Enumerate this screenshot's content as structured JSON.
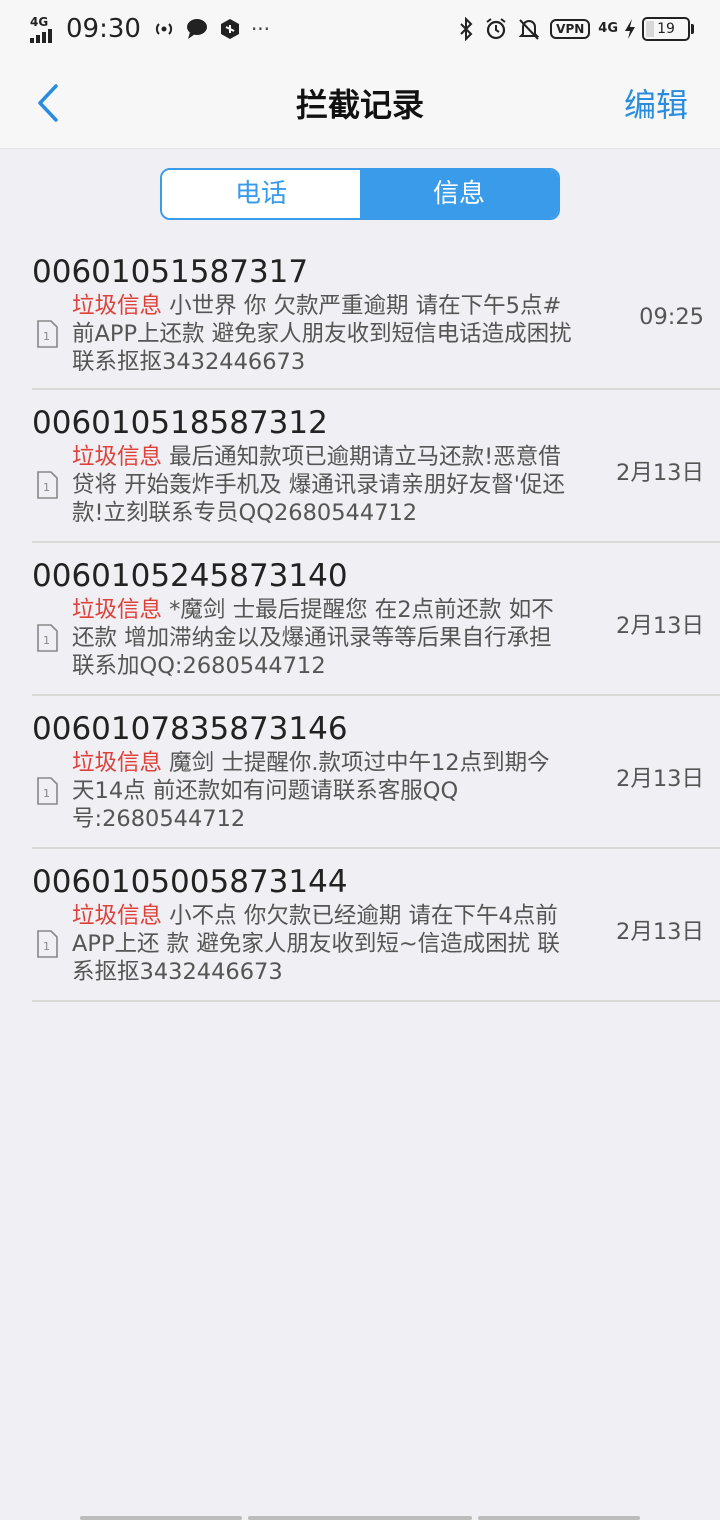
{
  "status_bar": {
    "network_left": "4G",
    "time": "09:30",
    "vpn": "VPN",
    "network_right": "4G",
    "battery": "19",
    "battery_level": 0.19,
    "more": "···"
  },
  "header": {
    "title": "拦截记录",
    "edit_label": "编辑"
  },
  "tabs": [
    {
      "label": "电话",
      "active": false
    },
    {
      "label": "信息",
      "active": true
    }
  ],
  "messages": [
    {
      "number": "00601051587317",
      "tag": "垃圾信息",
      "text": " 小世界  你 欠款严重逾期 请在下午5点#前APP上还款 避免家人朋友收到短信电话造成困扰 联系抠抠3432446673",
      "time": "09:25"
    },
    {
      "number": "006010518587312",
      "tag": "垃圾信息",
      "text": " 最后通知款项已逾期请立马还款!恶意借贷将 开始轰炸手机及 爆通讯录请亲朋好友督'促还款!立刻联系专员QQ2680544712",
      "time": "2月13日"
    },
    {
      "number": "0060105245873140",
      "tag": "垃圾信息",
      "text": " *魔剑 士最后提醒您 在2点前还款 如不还款 增加滞纳金以及爆通讯录等等后果自行承担 联系加QQ:2680544712",
      "time": "2月13日"
    },
    {
      "number": "0060107835873146",
      "tag": "垃圾信息",
      "text": " 魔剑 士提醒你.款项过中午12点到期今天14点 前还款如有问题请联系客服QQ号:2680544712",
      "time": "2月13日"
    },
    {
      "number": "0060105005873144",
      "tag": "垃圾信息",
      "text": " 小不点  你欠款已经逾期 请在下午4点前APP上还 款 避免家人朋友收到短~信造成困扰 联系抠抠3432446673",
      "time": "2月13日"
    }
  ],
  "colors": {
    "accent": "#3a9bea",
    "spam_tag": "#e0403a",
    "background": "#efeff4"
  }
}
